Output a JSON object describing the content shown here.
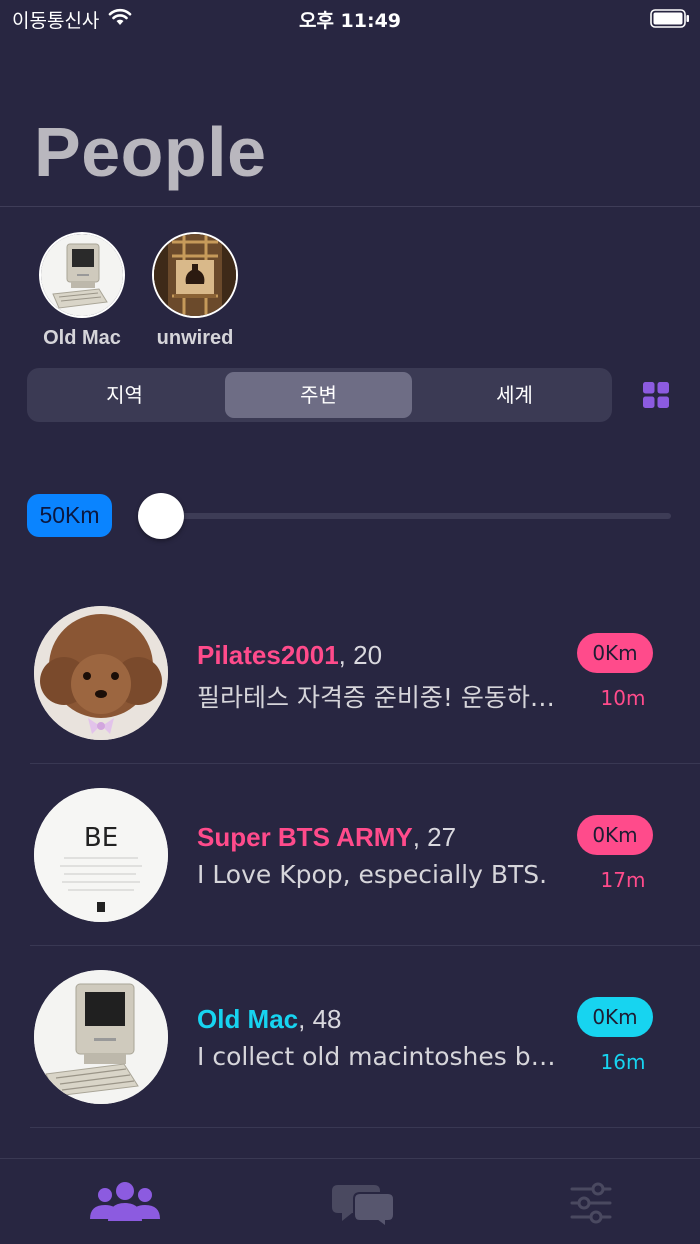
{
  "status_bar": {
    "carrier": "이동통신사",
    "time": "오후 11:49"
  },
  "page_title": "People",
  "favorites": [
    {
      "name": "Old Mac",
      "avatar": "old-mac-computer"
    },
    {
      "name": "unwired",
      "avatar": "vase-cabinet"
    }
  ],
  "segments": {
    "items": [
      "지역",
      "주변",
      "세계"
    ],
    "selected": "주변"
  },
  "distance_filter": {
    "label": "50Km",
    "slider_value": 0.05
  },
  "people": [
    {
      "name": "Pilates2001",
      "age": ", 20",
      "bio": "필라테스 자격증 준비중! 운동하…",
      "distance": "0Km",
      "time": "10m",
      "color": "#ff4b8b",
      "avatar": "poodle"
    },
    {
      "name": "Super BTS ARMY",
      "age": ", 27",
      "bio": "I Love Kpop, especially BTS.",
      "distance": "0Km",
      "time": "17m",
      "color": "#ff4b8b",
      "avatar": "be-album"
    },
    {
      "name": "Old Mac",
      "age": ", 48",
      "bio": "I collect old macintoshes b…",
      "distance": "0Km",
      "time": "16m",
      "color": "#17d4f0",
      "avatar": "old-mac-computer"
    }
  ],
  "tab_bar": {
    "items": [
      "people-icon",
      "chat-icon",
      "settings-sliders-icon"
    ],
    "active": "people-icon",
    "active_color": "#8c5be0",
    "inactive_color": "#4a4960"
  }
}
